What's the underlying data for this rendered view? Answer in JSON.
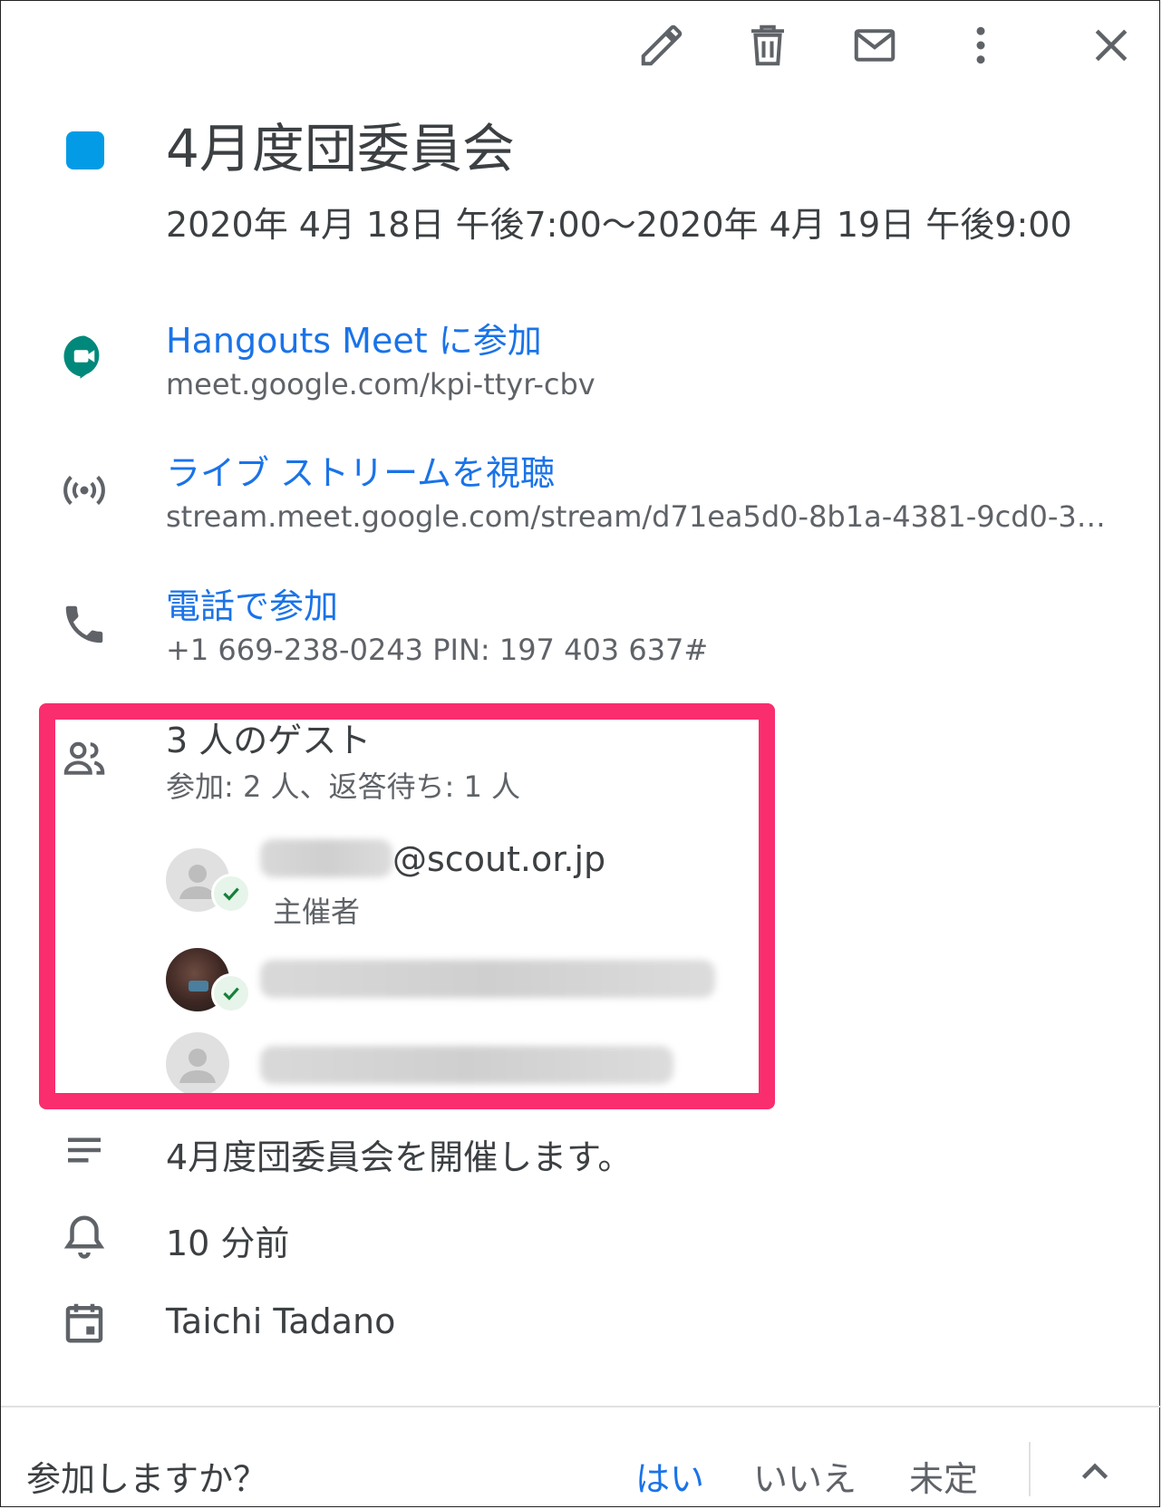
{
  "toolbar": {
    "edit_icon": "pencil-icon",
    "delete_icon": "trash-icon",
    "email_icon": "envelope-icon",
    "more_icon": "more-vert-icon",
    "close_icon": "close-icon"
  },
  "event": {
    "color": "#039be5",
    "title": "4月度団委員会",
    "datetime": "2020年 4月 18日 午後7:00〜2020年 4月 19日 午後9:00"
  },
  "meet": {
    "join_label": "Hangouts Meet に参加",
    "url": "meet.google.com/kpi-ttyr-cbv"
  },
  "stream": {
    "label": "ライブ ストリームを視聴",
    "url": "stream.meet.google.com/stream/d71ea5d0-8b1a-4381-9cd0-3…"
  },
  "phone": {
    "label": "電話で参加",
    "details": "+1 669-238-0243 PIN: 197 403 637#"
  },
  "guests": {
    "count_label": "3 人のゲスト",
    "summary": "参加: 2 人、返答待ち: 1 人",
    "list": [
      {
        "email_suffix": "@scout.or.jp",
        "role": "主催者",
        "status": "accepted"
      },
      {
        "status": "accepted"
      },
      {
        "status": "pending"
      }
    ]
  },
  "description": "4月度団委員会を開催します。",
  "reminder": "10 分前",
  "calendar_owner": "Taichi Tadano",
  "rsvp": {
    "question": "参加しますか？",
    "yes": "はい",
    "no": "いいえ",
    "maybe": "未定"
  },
  "colors": {
    "link": "#1a73e8",
    "highlight": "#fa2d6e",
    "meet_green": "#00897b"
  }
}
